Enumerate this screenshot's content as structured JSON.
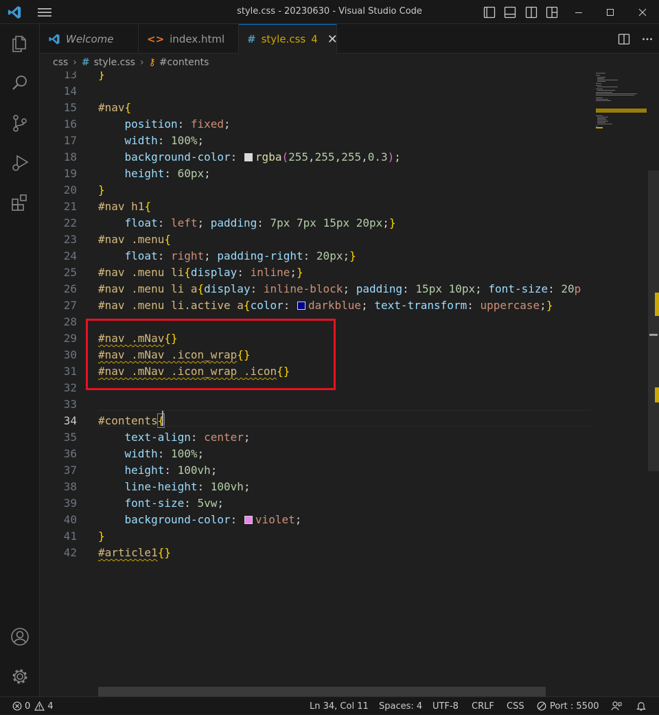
{
  "window": {
    "title": "style.css - 20230630 - Visual Studio Code"
  },
  "tabs": [
    {
      "label": "Welcome",
      "icon": "vscode-icon"
    },
    {
      "label": "index.html",
      "icon": "html-icon"
    },
    {
      "label": "style.css",
      "icon": "css-hash-icon",
      "badge": "4",
      "active": true
    }
  ],
  "breadcrumb": {
    "folder": "css",
    "file": "style.css",
    "symbol": "#contents"
  },
  "editor": {
    "current_line": 34,
    "lines": [
      {
        "n": "13",
        "t": "}"
      },
      {
        "n": "14",
        "t": ""
      },
      {
        "n": "15",
        "t": "#nav{"
      },
      {
        "n": "16",
        "t": "    position: fixed;"
      },
      {
        "n": "17",
        "t": "    width: 100%;"
      },
      {
        "n": "18",
        "t": "    background-color: rgba(255,255,255,0.3);"
      },
      {
        "n": "19",
        "t": "    height: 60px;"
      },
      {
        "n": "20",
        "t": "}"
      },
      {
        "n": "21",
        "t": "#nav h1{"
      },
      {
        "n": "22",
        "t": "    float: left; padding: 7px 7px 15px 20px;}"
      },
      {
        "n": "23",
        "t": "#nav .menu{"
      },
      {
        "n": "24",
        "t": "    float: right; padding-right: 20px;}"
      },
      {
        "n": "25",
        "t": "#nav .menu li{display: inline;}"
      },
      {
        "n": "26",
        "t": "#nav .menu li a{display: inline-block; padding: 15px 10px; font-size: 20p"
      },
      {
        "n": "27",
        "t": "#nav .menu li.active a{color: darkblue; text-transform: uppercase;}"
      },
      {
        "n": "28",
        "t": ""
      },
      {
        "n": "29",
        "t": "#nav .mNav{}"
      },
      {
        "n": "30",
        "t": "#nav .mNav .icon_wrap{}"
      },
      {
        "n": "31",
        "t": "#nav .mNav .icon_wrap .icon{}"
      },
      {
        "n": "32",
        "t": ""
      },
      {
        "n": "33",
        "t": ""
      },
      {
        "n": "34",
        "t": "#contents{"
      },
      {
        "n": "35",
        "t": "    text-align: center;"
      },
      {
        "n": "36",
        "t": "    width: 100%;"
      },
      {
        "n": "37",
        "t": "    height: 100vh;"
      },
      {
        "n": "38",
        "t": "    line-height: 100vh;"
      },
      {
        "n": "39",
        "t": "    font-size: 5vw;"
      },
      {
        "n": "40",
        "t": "    background-color: violet;"
      },
      {
        "n": "41",
        "t": "}"
      },
      {
        "n": "42",
        "t": "#article1{}"
      }
    ]
  },
  "statusbar": {
    "errors": "0",
    "warnings": "4",
    "position": "Ln 34, Col 11",
    "spaces": "Spaces: 4",
    "encoding": "UTF-8",
    "eol": "CRLF",
    "language": "CSS",
    "port": "Port : 5500"
  },
  "colors": {
    "accent": "#0078d4",
    "warning": "#cca700",
    "annotation": "#e81123",
    "swatch_rgba": "#d9d9d9",
    "swatch_darkblue": "#00008b",
    "swatch_violet": "#ee82ee"
  }
}
